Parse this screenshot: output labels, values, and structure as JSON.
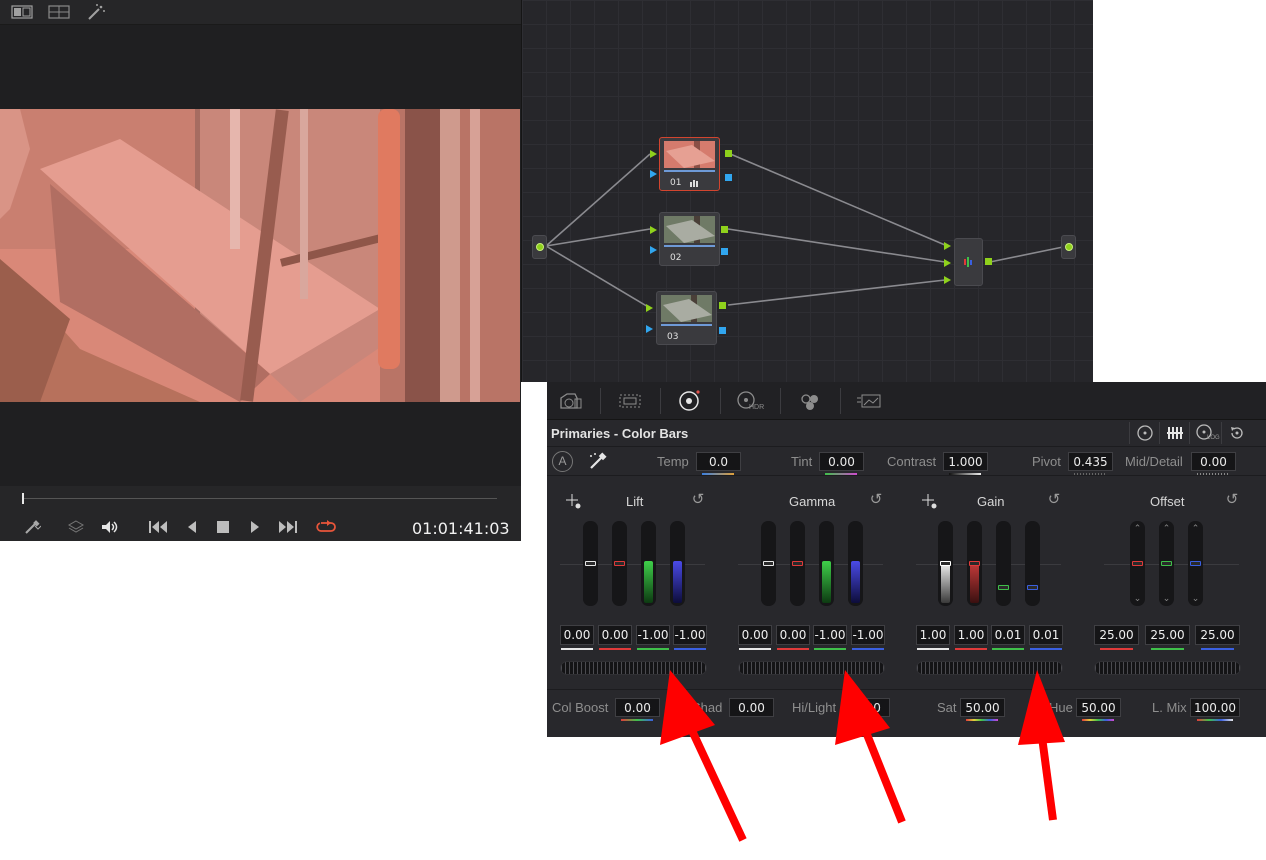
{
  "viewer": {
    "timecode": "01:01:41:03",
    "top_icons": [
      "single-viewer-icon",
      "split-viewer-icon",
      "magic-wand-icon"
    ],
    "transport_icons": [
      "picker-icon",
      "layers-icon",
      "speaker-icon",
      "skip-start-icon",
      "play-reverse-icon",
      "stop-icon",
      "play-icon",
      "skip-end-icon",
      "loop-icon"
    ]
  },
  "node_graph": {
    "nodes": [
      {
        "label": "01",
        "selected": true
      },
      {
        "label": "02",
        "selected": false
      },
      {
        "label": "03",
        "selected": false
      }
    ]
  },
  "palette": {
    "icons": [
      "camera-raw-icon",
      "color-match-icon",
      "color-wheels-icon",
      "hdr-icon",
      "rgb-mixer-icon",
      "motion-effects-icon"
    ],
    "hdr_label": "HDR"
  },
  "panel": {
    "title": "Primaries - Color Bars",
    "auto_label": "A",
    "temp_label": "Temp",
    "temp_value": "0.0",
    "tint_label": "Tint",
    "tint_value": "0.00",
    "contrast_label": "Contrast",
    "contrast_value": "1.000",
    "pivot_label": "Pivot",
    "pivot_value": "0.435",
    "middetail_label": "Mid/Detail",
    "middetail_value": "0.00",
    "log_label": "LOG"
  },
  "wheels": {
    "lift": {
      "title": "Lift",
      "values": [
        "0.00",
        "0.00",
        "-1.00",
        "-1.00"
      ]
    },
    "gamma": {
      "title": "Gamma",
      "values": [
        "0.00",
        "0.00",
        "-1.00",
        "-1.00"
      ]
    },
    "gain": {
      "title": "Gain",
      "values": [
        "1.00",
        "1.00",
        "0.01",
        "0.01"
      ]
    },
    "offset": {
      "title": "Offset",
      "values": [
        "25.00",
        "25.00",
        "25.00"
      ]
    }
  },
  "bottom": {
    "colboost_label": "Col Boost",
    "colboost_value": "0.00",
    "shad_label": "Shad",
    "shad_value": "0.00",
    "hilight_label": "Hi/Light",
    "hilight_value": "0.00",
    "sat_label": "Sat",
    "sat_value": "50.00",
    "hue_label": "Hue",
    "hue_value": "50.00",
    "lmix_label": "L. Mix",
    "lmix_value": "100.00"
  },
  "colors": {
    "white": "#e6e6e6",
    "red": "#e03a3a",
    "green": "#3fc04a",
    "blue": "#3a5fe0",
    "node_port_green": "#8fd11c",
    "node_port_blue": "#31a6ef",
    "arrow_red": "#ff0000"
  }
}
